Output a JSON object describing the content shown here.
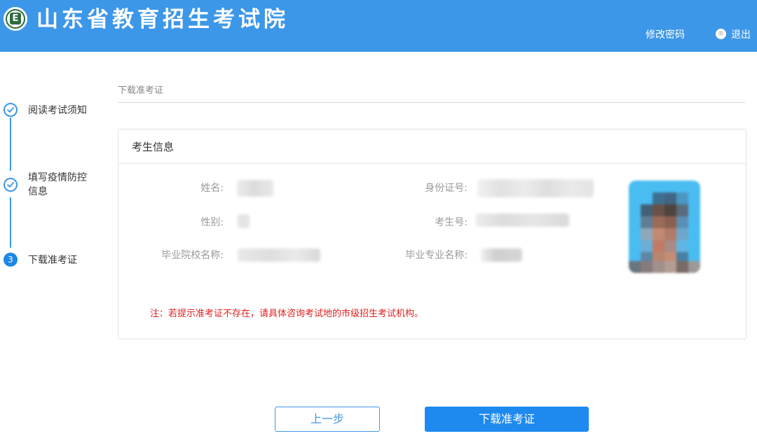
{
  "header": {
    "site_title": "山东省教育招生考试院",
    "logo_letter": "E",
    "change_password": "修改密码",
    "logout": "退出"
  },
  "steps": [
    {
      "label": "阅读考试须知",
      "status": "done"
    },
    {
      "label": "填写疫情防控信息",
      "status": "done"
    },
    {
      "label": "下载准考证",
      "status": "active",
      "number": "3"
    }
  ],
  "main": {
    "section_title": "下载准考证",
    "card_title": "考生信息",
    "fields": {
      "name_label": "姓名:",
      "id_label": "身份证号:",
      "gender_label": "性别:",
      "exam_no_label": "考生号:",
      "school_label": "毕业院校名称:",
      "major_label": "毕业专业名称:"
    },
    "notice": "注：若提示准考证不存在，请具体咨询考试地的市级招生考试机构。"
  },
  "buttons": {
    "prev": "上一步",
    "download": "下载准考证"
  },
  "colors": {
    "header_bg": "#3c97e8",
    "primary": "#1e8af0",
    "notice": "#e02020"
  }
}
